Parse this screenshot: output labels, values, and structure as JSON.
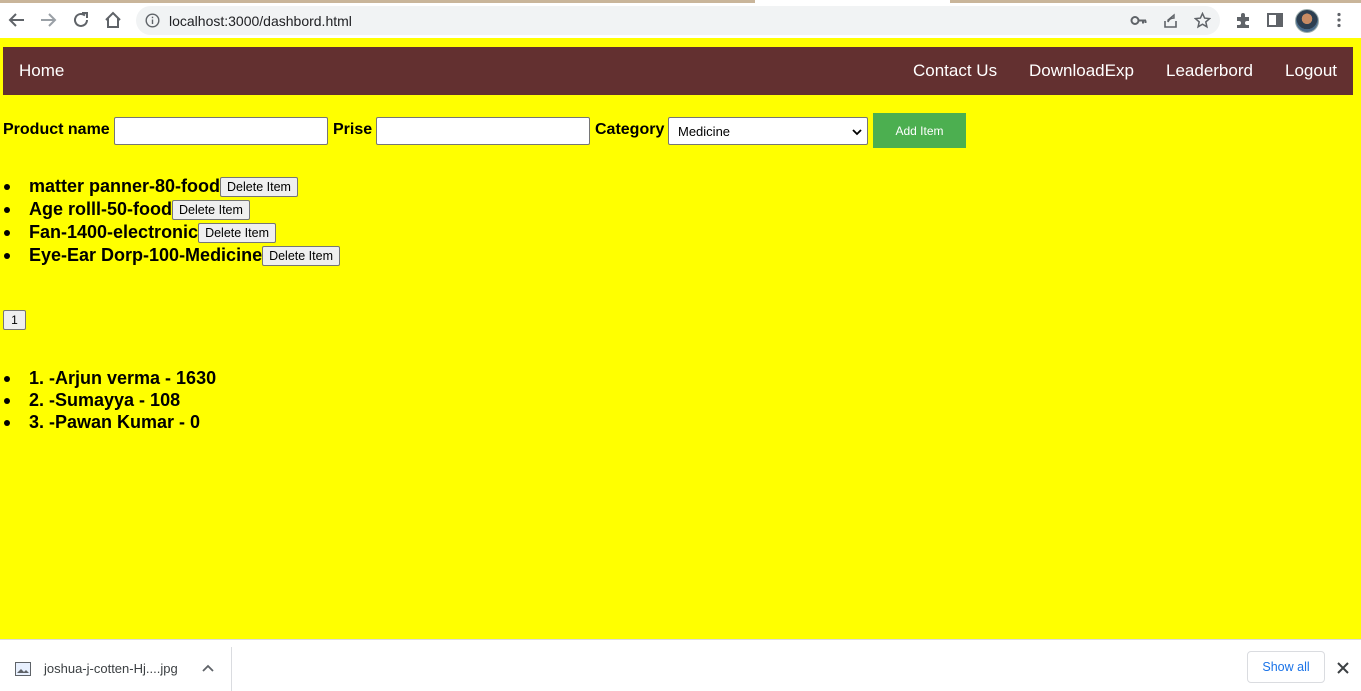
{
  "browser": {
    "url": "localhost:3000/dashbord.html"
  },
  "navbar": {
    "home": "Home",
    "contact": "Contact Us",
    "download": "DownloadExp",
    "leaderboard": "Leaderbord",
    "logout": "Logout",
    "bg_color": "#633030"
  },
  "form": {
    "product_label": "Product name",
    "product_value": "",
    "price_label": "Prise",
    "price_value": "",
    "category_label": "Category",
    "category_selected": "Medicine",
    "add_button": "Add Item",
    "add_button_color": "#4caf50"
  },
  "items": [
    {
      "text": "matter panner-80-food",
      "delete": "Delete Item"
    },
    {
      "text": "Age rolll-50-food",
      "delete": "Delete Item"
    },
    {
      "text": "Fan-1400-electronic",
      "delete": "Delete Item"
    },
    {
      "text": "Eye-Ear Dorp-100-Medicine",
      "delete": "Delete Item"
    }
  ],
  "pagination": {
    "page": "1"
  },
  "leaderboard": [
    {
      "text": "1. -Arjun verma - 1630"
    },
    {
      "text": "2. -Sumayya - 108"
    },
    {
      "text": "3. -Pawan Kumar - 0"
    }
  ],
  "download_bar": {
    "filename": "joshua-j-cotten-Hj....jpg",
    "show_all": "Show all"
  },
  "page_bg": "#ffff00"
}
